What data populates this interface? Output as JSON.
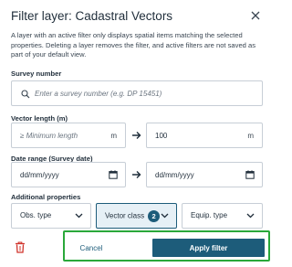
{
  "dialog": {
    "title": "Filter layer: Cadastral Vectors",
    "description": "A layer with an active filter only displays spatial items matching the selected properties. Deleting a layer removes the filter, and active filters are not saved as part of your default view."
  },
  "survey_number": {
    "label": "Survey number",
    "placeholder": "Enter a survey number (e.g. DP 15451)"
  },
  "vector_length": {
    "label": "Vector length (m)",
    "min_placeholder": "≥ Minimum length",
    "min_unit": "m",
    "max_value": "100",
    "max_unit": "m"
  },
  "date_range": {
    "label": "Date range (Survey date)",
    "from_value": "dd/mm/yyyy",
    "to_value": "dd/mm/yyyy"
  },
  "additional_properties": {
    "label": "Additional properties",
    "obs_type": "Obs. type",
    "vector_class": "Vector class",
    "vector_class_count": "2",
    "equip_type": "Equip. type"
  },
  "actions": {
    "cancel_label": "Cancel",
    "apply_label": "Apply filter"
  },
  "colors": {
    "accent": "#1d5c7a",
    "delete": "#d0342c",
    "highlight_box": "#2aa83a",
    "active_dropdown_bg": "#e6f0f6"
  },
  "icons": {
    "close": "close-icon",
    "search": "search-icon",
    "arrow": "arrow-right-icon",
    "calendar": "calendar-icon",
    "chevron": "chevron-down-icon",
    "trash": "trash-icon"
  }
}
